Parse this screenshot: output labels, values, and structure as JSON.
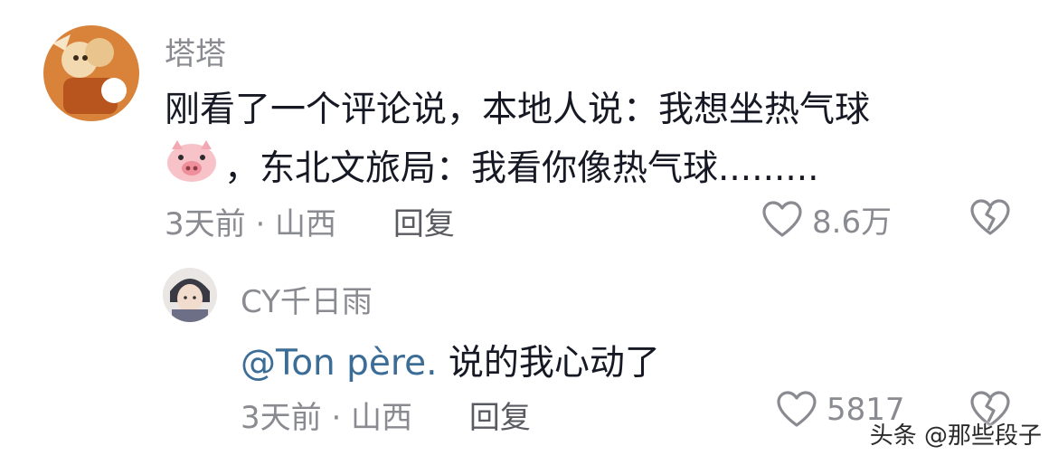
{
  "comments": [
    {
      "username": "塔塔",
      "line1": "刚看了一个评论说，本地人说：我想坐热气球",
      "line2": "，东北文旅局：我看你像热气球.........",
      "emoji": "pig-face-icon",
      "time_location": "3天前 · 山西",
      "reply_label": "回复",
      "like_count": "8.6万"
    },
    {
      "username": "CY千日雨",
      "mention": "@Ton père.",
      "text": " 说的我心动了",
      "time_location": "3天前 · 山西",
      "reply_label": "回复",
      "like_count": "5817"
    }
  ],
  "watermark": "头条 @那些段子",
  "colors": {
    "username": "#8a8b91",
    "text": "#161823",
    "mention": "#3b6d97",
    "meta": "#8a8b91"
  }
}
